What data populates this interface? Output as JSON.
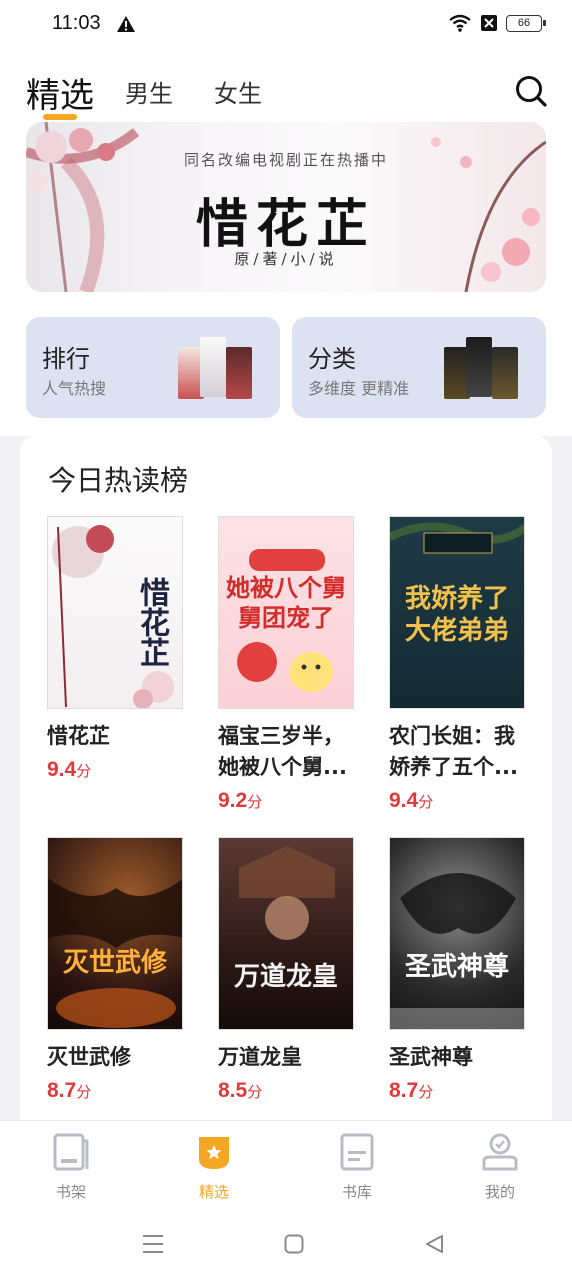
{
  "status_bar": {
    "time": "11:03",
    "battery": "66"
  },
  "top_tabs": [
    {
      "label": "精选",
      "active": true
    },
    {
      "label": "男生",
      "active": false
    },
    {
      "label": "女生",
      "active": false
    }
  ],
  "banner": {
    "subtitle": "同名改编电视剧正在热播中",
    "title": "惜花芷",
    "caption": "原/著/小/说"
  },
  "entries": [
    {
      "title": "排行",
      "subtitle": "人气热搜"
    },
    {
      "title": "分类",
      "subtitle": "多维度 更精准"
    }
  ],
  "rank": {
    "title": "今日热读榜",
    "books": [
      {
        "name": "惜花芷",
        "score": "9.4",
        "unit": "分",
        "cover_title": "惜花芷"
      },
      {
        "name": "福宝三岁半，她被八个舅...",
        "score": "9.2",
        "unit": "分",
        "cover_title": "她被八个舅舅团宠了"
      },
      {
        "name": "农门长姐：我娇养了五个...",
        "score": "9.4",
        "unit": "分",
        "cover_title": "我娇养了大佬弟弟"
      },
      {
        "name": "灭世武修",
        "score": "8.7",
        "unit": "分",
        "cover_title": "灭世武修"
      },
      {
        "name": "万道龙皇",
        "score": "8.5",
        "unit": "分",
        "cover_title": "万道龙皇"
      },
      {
        "name": "圣武神尊",
        "score": "8.7",
        "unit": "分",
        "cover_title": "圣武神尊"
      }
    ]
  },
  "bottom_nav": [
    {
      "label": "书架",
      "icon": "bookshelf-icon",
      "active": false
    },
    {
      "label": "精选",
      "icon": "featured-icon",
      "active": true
    },
    {
      "label": "书库",
      "icon": "library-icon",
      "active": false
    },
    {
      "label": "我的",
      "icon": "profile-icon",
      "active": false
    }
  ],
  "colors": {
    "accent": "#f5a623",
    "score": "#e0393b",
    "entry_card": "#dde2f3"
  }
}
